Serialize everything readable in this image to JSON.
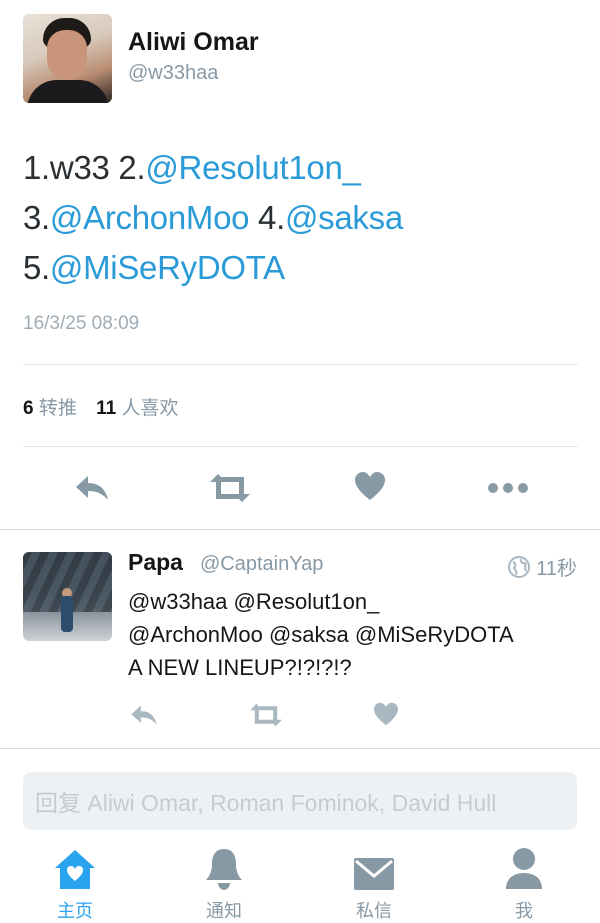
{
  "tweet": {
    "author": {
      "display_name": "Aliwi Omar",
      "handle": "@w33haa"
    },
    "text_parts": [
      "1.w33 2.",
      "@Resolut1on_",
      "3.",
      "@ArchonMoo",
      " 4.",
      "@saksa",
      "5.",
      "@MiSeRyDOTA"
    ],
    "timestamp": "16/3/25 08:09",
    "stats": {
      "retweets_count": "6",
      "retweets_label": "转推",
      "likes_count": "11",
      "likes_label": "人喜欢"
    },
    "actions": [
      "reply-icon",
      "retweet-icon",
      "heart-icon",
      "more-icon"
    ]
  },
  "reply": {
    "display_name": "Papa",
    "handle": "@CaptainYap",
    "time": "11秒",
    "text_lines": [
      "@w33haa @Resolut1on_",
      "@ArchonMoo @saksa @MiSeRyDOTA",
      "A NEW LINEUP?!?!?!?"
    ],
    "actions": [
      "reply-icon",
      "retweet-icon",
      "heart-icon"
    ]
  },
  "compose": {
    "placeholder": "回复 Aliwi Omar, Roman Fominok, David Hull"
  },
  "tabbar": {
    "items": [
      {
        "label": "主页",
        "icon": "home-icon",
        "active": true
      },
      {
        "label": "通知",
        "icon": "bell-icon",
        "active": false
      },
      {
        "label": "私信",
        "icon": "envelope-icon",
        "active": false
      },
      {
        "label": "我",
        "icon": "person-icon",
        "active": false
      }
    ]
  },
  "colors": {
    "accent": "#2aa3ef",
    "mention": "#2b9bd8",
    "icon_gray": "#8899a6",
    "divider": "#e1e8ed"
  }
}
